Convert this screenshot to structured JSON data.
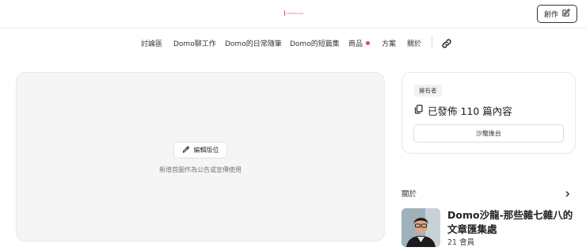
{
  "header": {
    "logo_text": "DOMOSALON",
    "create_label": "創作"
  },
  "nav": {
    "items": [
      {
        "label": "討論區"
      },
      {
        "label": "Domo聊工作"
      },
      {
        "label": "Domo的日常隨筆"
      },
      {
        "label": "Domo的短篇集"
      },
      {
        "label": "商品",
        "has_badge": true
      },
      {
        "label": "方案"
      },
      {
        "label": "關於"
      }
    ],
    "badge_color": "#e04848"
  },
  "cover": {
    "edit_label": "編輯版位",
    "hint": "新增首圖作為公告或宣傳使用"
  },
  "owner": {
    "badge": "擁有者",
    "posts_text": "已發佈 110 篇內容",
    "backend_label": "沙龍後台"
  },
  "about": {
    "label": "關於",
    "title": "Domo沙龍-那些雜七雜八的文章匯集處",
    "members": "21 會員"
  },
  "icons": {
    "create": "edit-square-icon",
    "edit_cover": "pencil-icon",
    "posts": "copy-icon",
    "nav_link": "link-icon",
    "about_arrow": "chevron-right-icon"
  }
}
